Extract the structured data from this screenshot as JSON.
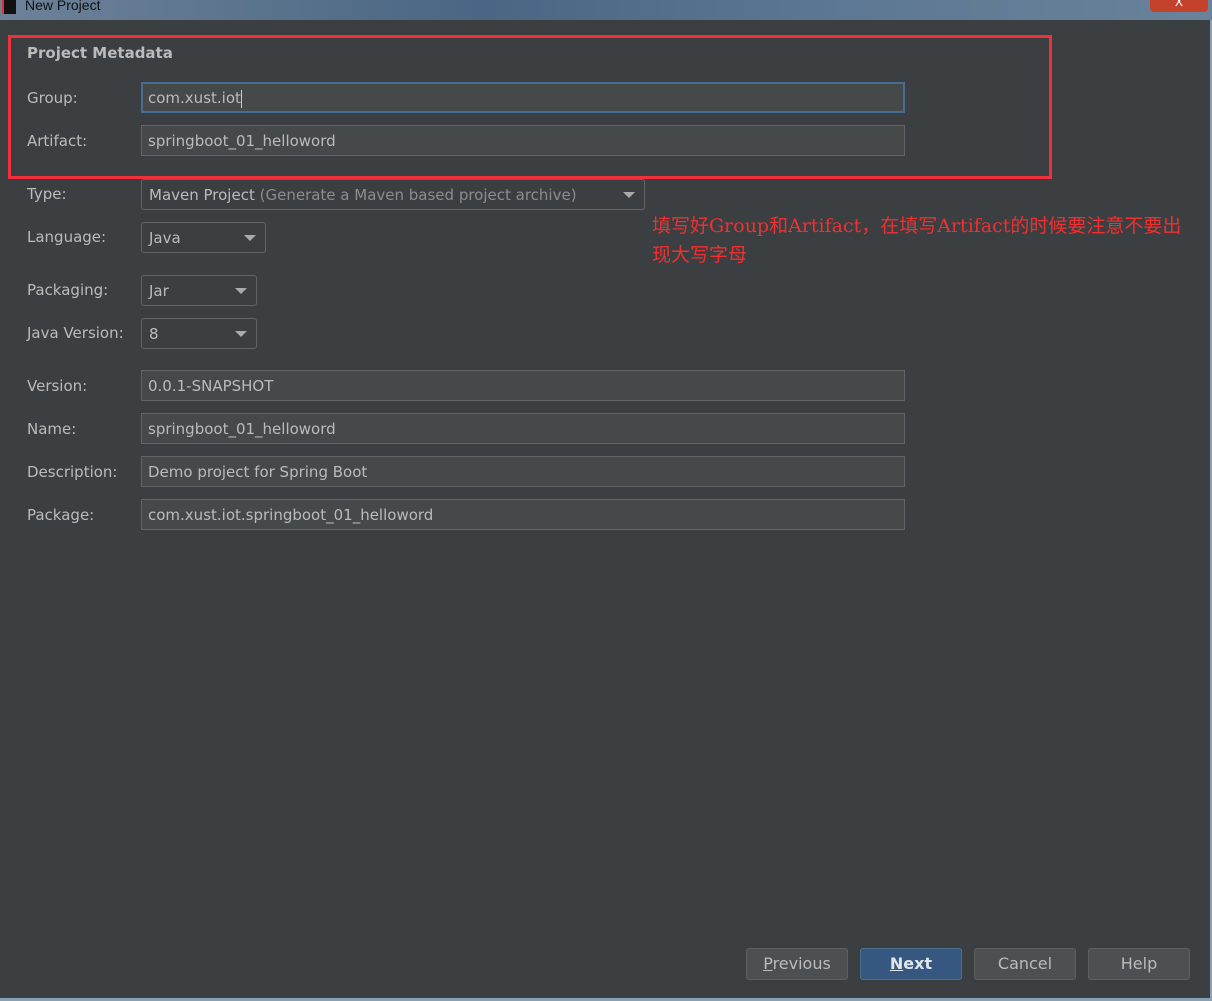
{
  "window": {
    "title": "New Project",
    "close_label": "X"
  },
  "section_title": "Project Metadata",
  "fields": {
    "group": {
      "label": "Group:",
      "value": "com.xust.iot"
    },
    "artifact": {
      "label": "Artifact:",
      "value": "springboot_01_helloword"
    },
    "type": {
      "label": "Type:",
      "value": "Maven Project",
      "hint": "(Generate a Maven based project archive)"
    },
    "language": {
      "label": "Language:",
      "value": "Java"
    },
    "packaging": {
      "label": "Packaging:",
      "value": "Jar"
    },
    "java_version": {
      "label": "Java Version:",
      "value": "8"
    },
    "version": {
      "label": "Version:",
      "value": "0.0.1-SNAPSHOT"
    },
    "name": {
      "label": "Name:",
      "value": "springboot_01_helloword"
    },
    "description": {
      "label": "Description:",
      "value": "Demo project for Spring Boot"
    },
    "package": {
      "label": "Package:",
      "value": "com.xust.iot.springboot_01_helloword"
    }
  },
  "annotation": "填写好Group和Artifact，在填写Artifact的时候要注意不要出现大写字母",
  "buttons": {
    "previous_mnemonic": "P",
    "previous_rest": "revious",
    "next_mnemonic": "N",
    "next_rest": "ext",
    "cancel": "Cancel",
    "help": "Help"
  },
  "colors": {
    "annotation": "#f03030",
    "primary": "#365880",
    "background": "#3c3f41"
  }
}
